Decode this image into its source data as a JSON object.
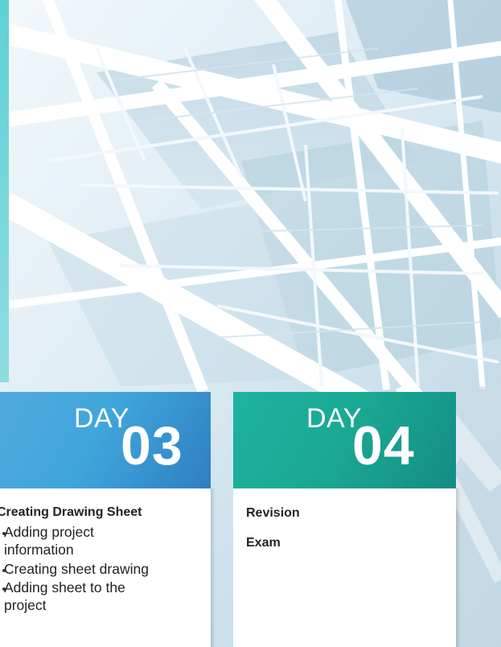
{
  "cards": [
    {
      "day_word": "DAY",
      "day_number": "03",
      "title": "Creating Drawing Sheet",
      "items": [
        {
          "lines": [
            "Adding project",
            "information"
          ]
        },
        {
          "lines": [
            "Creating sheet drawing"
          ]
        },
        {
          "lines": [
            "Adding sheet to the",
            "project"
          ]
        }
      ],
      "color": "#3fa6db"
    },
    {
      "day_word": "DAY",
      "day_number": "04",
      "entries": [
        "Revision",
        "Exam"
      ],
      "color": "#1aa893"
    }
  ]
}
